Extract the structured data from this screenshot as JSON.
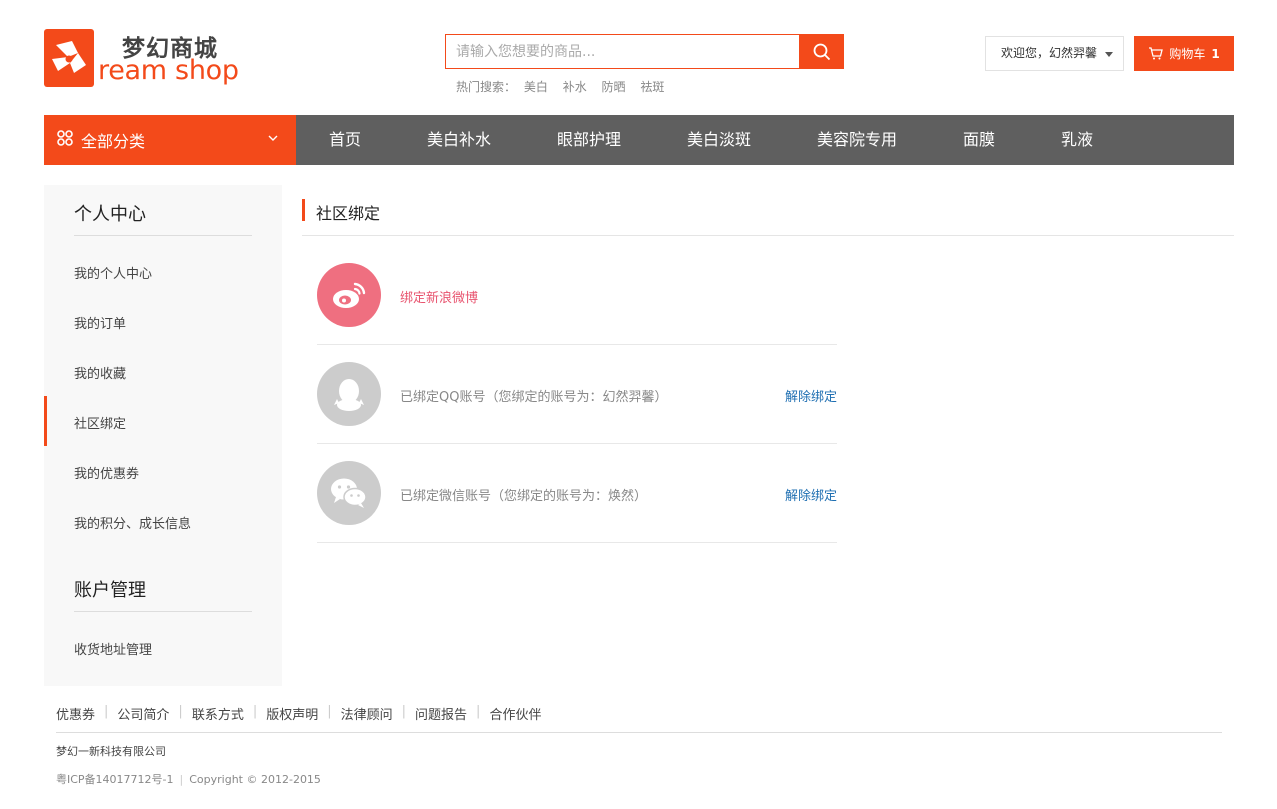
{
  "brand": {
    "name_cn": "梦幻商城",
    "name_en": "ream shop",
    "accent": "#f34a1a"
  },
  "search": {
    "placeholder": "请输入您想要的商品...",
    "hot_label": "热门搜索：",
    "hot_terms": [
      "美白",
      "补水",
      "防晒",
      "祛斑"
    ]
  },
  "user": {
    "welcome": "欢迎您，幻然羿馨",
    "cart_label": "购物车",
    "cart_count": "1"
  },
  "nav": {
    "all_label": "全部分类",
    "items": [
      "首页",
      "美白补水",
      "眼部护理",
      "美白淡斑",
      "美容院专用",
      "面膜",
      "乳液"
    ]
  },
  "sidebar": {
    "section1_title": "个人中心",
    "section1_items": [
      "我的个人中心",
      "我的订单",
      "我的收藏",
      "社区绑定",
      "我的优惠券",
      "我的积分、成长信息"
    ],
    "section2_title": "账户管理",
    "section2_items": [
      "收货地址管理"
    ],
    "active_item": "社区绑定"
  },
  "main": {
    "title": "社区绑定",
    "rows": [
      {
        "icon": "weibo-icon",
        "text": "绑定新浪微博",
        "action": "",
        "color": "#e8546f",
        "icon_bg": "#ef6f80"
      },
      {
        "icon": "qq-icon",
        "text": "已绑定QQ账号（您绑定的账号为：幻然羿馨）",
        "action": "解除绑定",
        "color": "#888888",
        "icon_bg": "#cccccc"
      },
      {
        "icon": "wechat-icon",
        "text": "已绑定微信账号（您绑定的账号为：焕然）",
        "action": "解除绑定",
        "color": "#888888",
        "icon_bg": "#cccccc"
      }
    ]
  },
  "footer": {
    "links": [
      "优惠券",
      "公司简介",
      "联系方式",
      "版权声明",
      "法律顾问",
      "问题报告",
      "合作伙伴"
    ],
    "company": "梦幻一新科技有限公司",
    "icp": "粤ICP备14017712号-1",
    "copyright": "Copyright © 2012-2015"
  }
}
